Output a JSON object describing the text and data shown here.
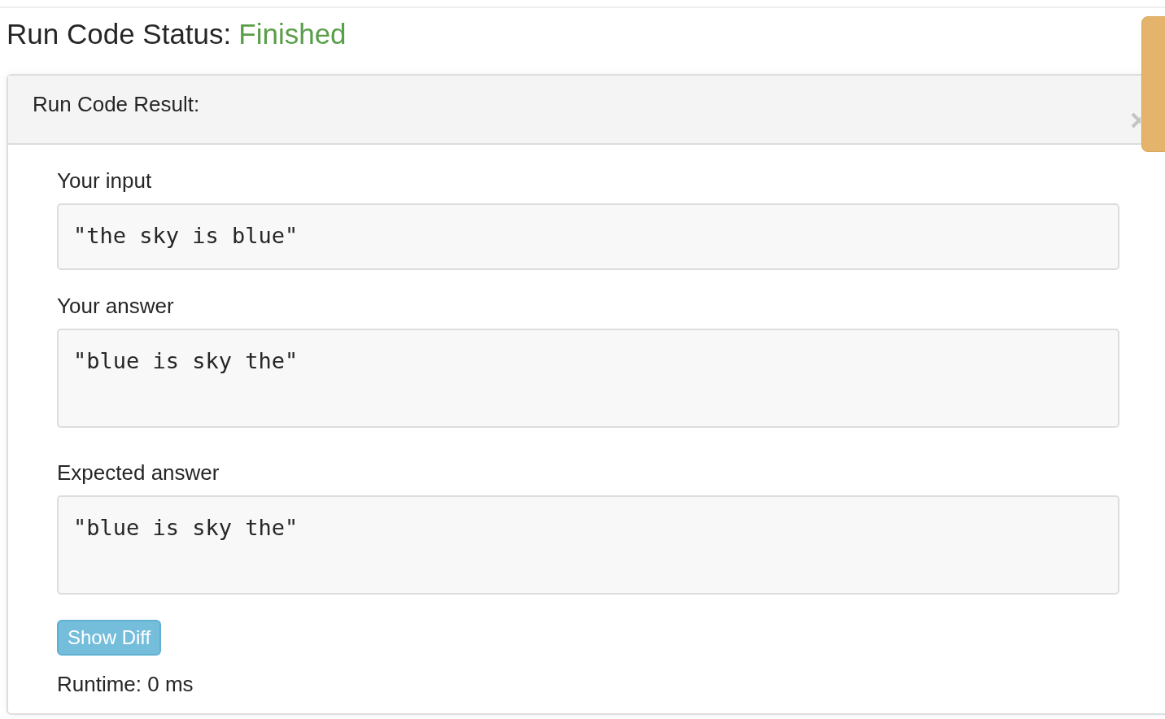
{
  "status": {
    "label": "Run Code Status:",
    "value": "Finished"
  },
  "panel": {
    "title": "Run Code Result:",
    "sections": [
      {
        "label": "Your input",
        "value": "\"the sky is blue\"",
        "kind": "short"
      },
      {
        "label": "Your answer",
        "value": "\"blue is sky the\"",
        "kind": "tall"
      },
      {
        "label": "Expected answer",
        "value": "\"blue is sky the\"",
        "kind": "tall"
      }
    ],
    "button": "Show Diff",
    "runtime": "Runtime: 0 ms"
  }
}
